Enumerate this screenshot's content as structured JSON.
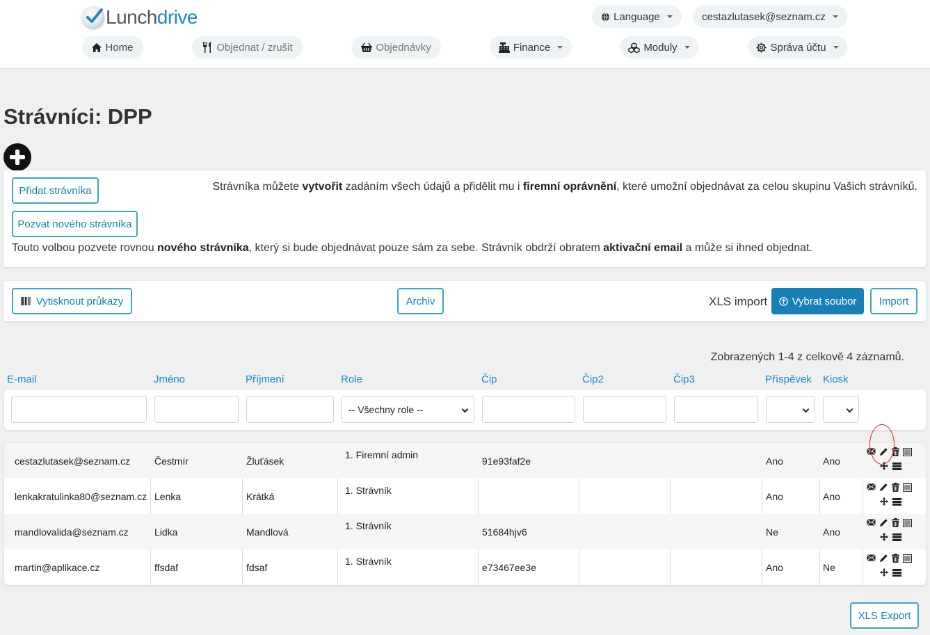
{
  "brand": {
    "part1": "Lunch",
    "part2": "drive"
  },
  "header": {
    "language_label": "Language",
    "user_email": "cestazlutasek@seznam.cz"
  },
  "nav": {
    "home": "Home",
    "order": "Objednat / zrušit",
    "orders": "Objednávky",
    "finance": "Finance",
    "modules": "Moduly",
    "account": "Správa účtu"
  },
  "page": {
    "title": "Strávníci: DPP"
  },
  "add_panel": {
    "add_button": "Přidat strávníka",
    "invite_button": "Pozvat nového strávníka",
    "text1_a": "Strávníka můžete ",
    "text1_b": "vytvořit",
    "text1_c": " zadáním všech údajů a přidělit mu i ",
    "text1_d": "firemní oprávnění",
    "text1_e": ", které umožní objednávat za celou skupinu Vašich strávníků.",
    "text2_a": "Touto volbou pozvete rovnou ",
    "text2_b": "nového strávníka",
    "text2_c": ", který si bude objednávat pouze sám za sebe. Strávník obdrží obratem ",
    "text2_d": "aktivační email",
    "text2_e": " a může si ihned objednat."
  },
  "toolbar": {
    "print_cards": "Vytisknout průkazy",
    "archive": "Archiv",
    "xls_import": "XLS import",
    "choose_file": "Vybrat soubor",
    "import": "Import"
  },
  "table": {
    "summary": "Zobrazených 1-4 z celkově 4 záznamů.",
    "columns": [
      "E-mail",
      "Jméno",
      "Příjmení",
      "Role",
      "Čip",
      "Čip2",
      "Čip3",
      "Příspěvek",
      "Kiosk"
    ],
    "role_filter": "-- Všechny role --",
    "rows": [
      {
        "email": "cestazlutasek@seznam.cz",
        "first": "Čestmír",
        "last": "Žluťásek",
        "role": "1. Firemní admin",
        "chip": "91e93faf2e",
        "chip2": "",
        "chip3": "",
        "contribution": "Ano",
        "kiosk": "Ano"
      },
      {
        "email": "lenkakratulinka80@seznam.cz",
        "first": "Lenka",
        "last": "Krátká",
        "role": "1. Strávník",
        "chip": "",
        "chip2": "",
        "chip3": "",
        "contribution": "Ano",
        "kiosk": "Ano"
      },
      {
        "email": "mandlovalida@seznam.cz",
        "first": "Lidka",
        "last": "Mandlová",
        "role": "1. Strávník",
        "chip": "51684hjv6",
        "chip2": "",
        "chip3": "",
        "contribution": "Ne",
        "kiosk": "Ano"
      },
      {
        "email": "martin@aplikace.cz",
        "first": "ffsdaf",
        "last": "fdsaf",
        "role": "1. Strávník",
        "chip": "e73467ee3e",
        "chip2": "",
        "chip3": "",
        "contribution": "Ano",
        "kiosk": "Ne"
      }
    ]
  },
  "export": {
    "xls_export": "XLS Export"
  },
  "colors": {
    "accent": "#1780b5",
    "link": "#1a8ac6",
    "annotation": "#e0202a"
  }
}
